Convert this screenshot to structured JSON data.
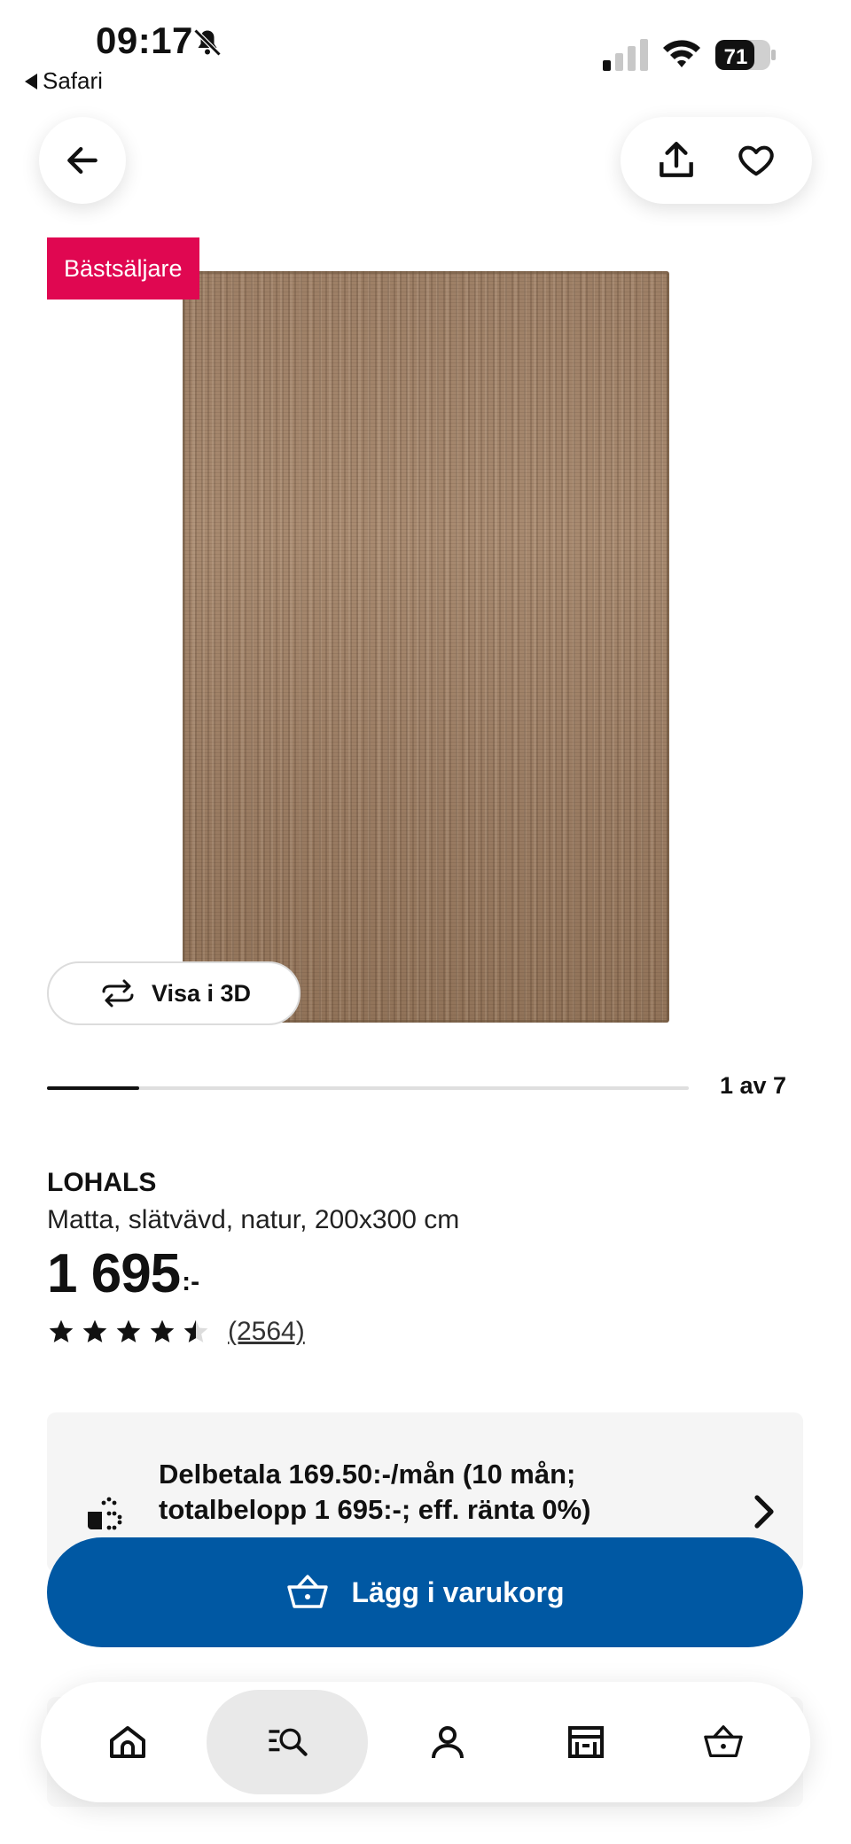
{
  "status_bar": {
    "time": "09:17",
    "back_app_label": "Safari",
    "battery_level": "71"
  },
  "product": {
    "badge": "Bästsäljare",
    "view_3d_label": "Visa i 3D",
    "carousel": {
      "counter": "1 av 7",
      "progress_fraction": 0.143
    },
    "name": "LOHALS",
    "description": "Matta, slätvävd, natur, 200x300 cm",
    "price_number": "1 695",
    "price_suffix": ":-",
    "rating_value": 4.5,
    "rating_max": 5,
    "review_count": "(2564)"
  },
  "installment": {
    "line1": "Delbetala 169.50:-/mån (10 mån;",
    "line2": "totalbelopp 1 695:-; eff. ränta 0%)"
  },
  "cart_button": {
    "label": "Lägg i varukorg"
  },
  "colors": {
    "badge_bg": "#e00751",
    "primary_blue": "#0058a3",
    "rug_tone": "#a1836a"
  },
  "icons": {
    "back": "arrow-left-icon",
    "share": "share-icon",
    "favorite": "heart-icon",
    "rotate": "rotate-3d-icon",
    "installment": "hand-coins-icon",
    "chevron": "chevron-right-icon",
    "basket": "basket-icon"
  },
  "nav": {
    "items": [
      {
        "name": "home",
        "icon": "home-icon"
      },
      {
        "name": "search",
        "icon": "search-list-icon",
        "active": true
      },
      {
        "name": "profile",
        "icon": "person-icon"
      },
      {
        "name": "store",
        "icon": "store-icon"
      },
      {
        "name": "cart",
        "icon": "basket-icon"
      }
    ]
  }
}
